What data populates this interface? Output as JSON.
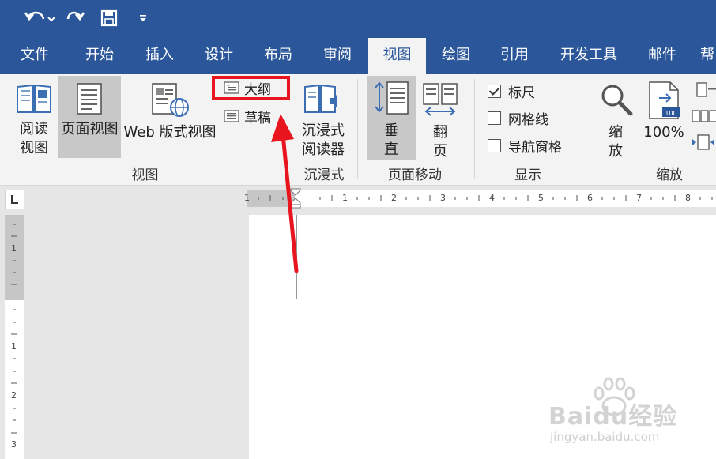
{
  "qat": {
    "undo_icon": "undo-arrow-icon",
    "redo_icon": "redo-arrow-icon",
    "save_icon": "floppy-save-icon",
    "customize_icon": "dropdown-arrow-icon"
  },
  "tabs": [
    {
      "label": "文件"
    },
    {
      "label": "开始"
    },
    {
      "label": "插入"
    },
    {
      "label": "设计"
    },
    {
      "label": "布局"
    },
    {
      "label": "审阅"
    },
    {
      "label": "视图",
      "active": true
    },
    {
      "label": "绘图"
    },
    {
      "label": "引用"
    },
    {
      "label": "开发工具"
    },
    {
      "label": "邮件"
    },
    {
      "label": "帮"
    }
  ],
  "ribbon": {
    "views": {
      "read_mode_l1": "阅读",
      "read_mode_l2": "视图",
      "print_layout": "页面视图",
      "web_layout": "Web 版式视图",
      "outline": "大纲",
      "draft": "草稿",
      "group_label": "视图"
    },
    "immersive": {
      "reader_l1": "沉浸式",
      "reader_l2": "阅读器",
      "group_label": "沉浸式"
    },
    "page_movement": {
      "vertical_l1": "垂",
      "vertical_l2": "直",
      "side_l1": "翻",
      "side_l2": "页",
      "group_label": "页面移动"
    },
    "show": {
      "ruler": "标尺",
      "ruler_checked": true,
      "gridlines": "网格线",
      "gridlines_checked": false,
      "nav_pane": "导航窗格",
      "nav_pane_checked": false,
      "group_label": "显示"
    },
    "zoom": {
      "zoom_l1": "缩",
      "zoom_l2": "放",
      "hundred": "100%",
      "hundred_badge": "100",
      "group_label": "缩放"
    }
  },
  "ruler": {
    "h_numbers": [
      "1",
      "1",
      "2",
      "3",
      "4",
      "5",
      "6",
      "7",
      "8"
    ],
    "v_numbers": [
      "1",
      "1",
      "2",
      "3"
    ]
  },
  "annotation": {
    "highlight_color": "#e8141e",
    "arrow_color": "#e8141e"
  },
  "watermark": {
    "brand": "Baidu经验",
    "url": "jingyan.baidu.com"
  },
  "colors": {
    "accent": "#2b579a",
    "ribbon_bg": "#f3f3f3"
  }
}
